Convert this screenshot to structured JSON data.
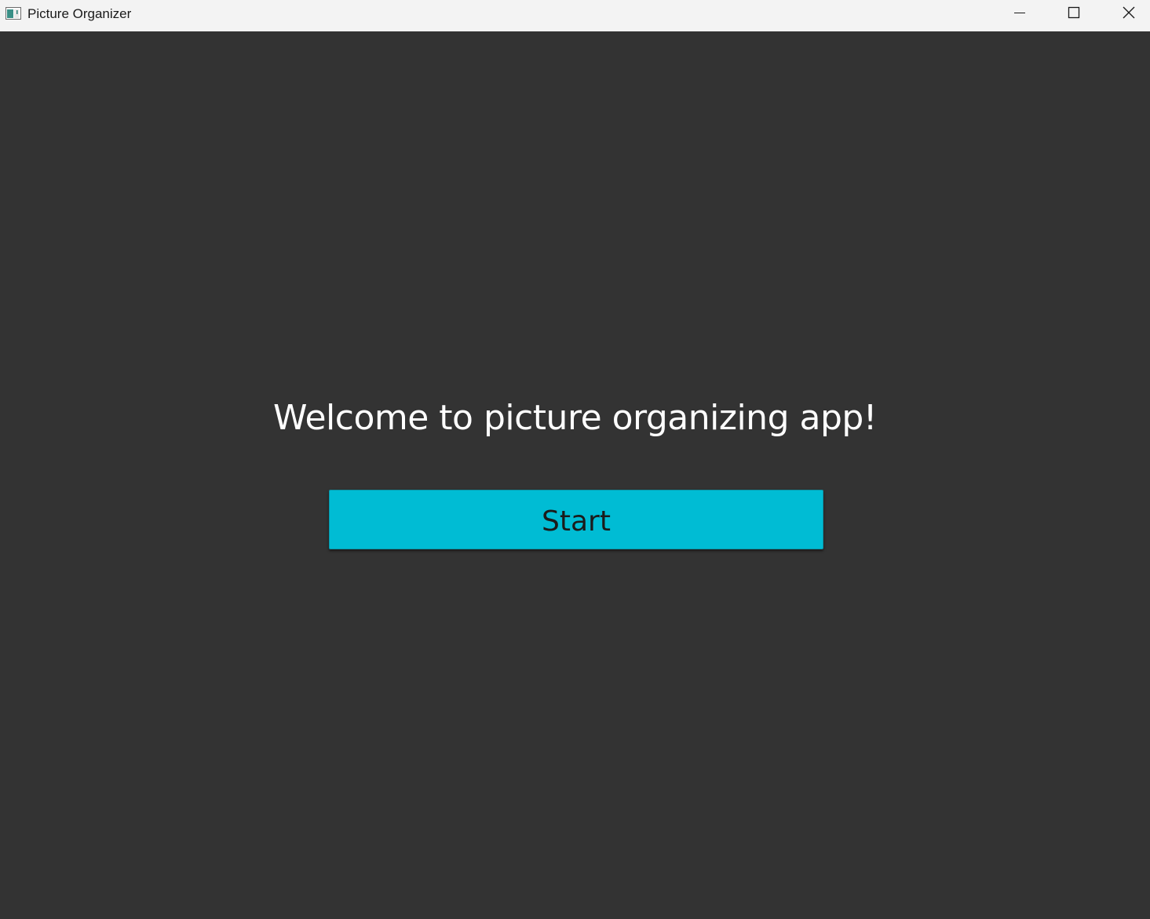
{
  "window": {
    "title": "Picture Organizer",
    "icon": "app-window-icon",
    "controls": {
      "minimize_icon": "minimize-icon",
      "maximize_icon": "maximize-icon",
      "close_icon": "close-icon"
    }
  },
  "main": {
    "welcome_text": "Welcome to picture organizing app!",
    "start_label": "Start"
  },
  "colors": {
    "background": "#333333",
    "titlebar": "#f3f3f3",
    "accent": "#00bcd4",
    "welcome_text": "#ffffff"
  }
}
